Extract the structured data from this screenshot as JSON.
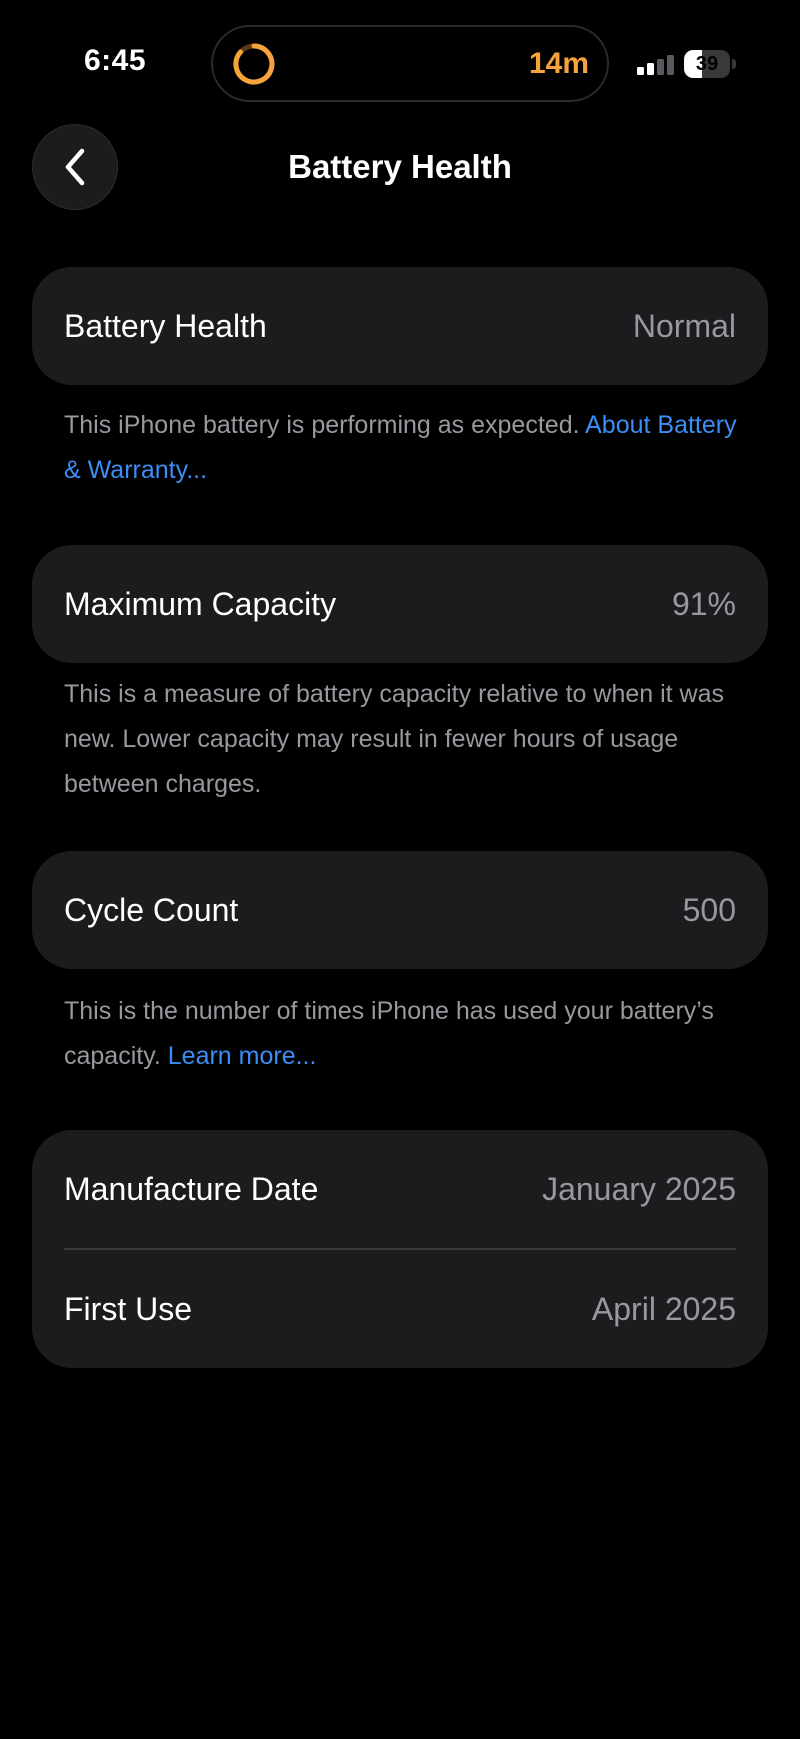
{
  "status_bar": {
    "time": "6:45",
    "timer": "14m",
    "battery_level": "39",
    "battery_fraction": 0.39
  },
  "nav": {
    "title": "Battery Health"
  },
  "battery_health": {
    "label": "Battery Health",
    "value": "Normal",
    "footnote": "This iPhone battery is performing as expected.",
    "link": "About Battery & Warranty..."
  },
  "maximum_capacity": {
    "label": "Maximum Capacity",
    "value": "91%",
    "footnote": "This is a measure of battery capacity relative to when it was new. Lower capacity may result in fewer hours of usage between charges."
  },
  "cycle_count": {
    "label": "Cycle Count",
    "value": "500",
    "footnote": "This is the number of times iPhone has used your battery’s capacity.",
    "link": "Learn more..."
  },
  "dates": {
    "manufacture_label": "Manufacture Date",
    "manufacture_value": "January 2025",
    "first_use_label": "First Use",
    "first_use_value": "April 2025"
  },
  "colors": {
    "background": "#000000",
    "card": "#1c1c1e",
    "link": "#3b8ef5",
    "timer": "#f7a33c",
    "secondary_text": "#98989f"
  },
  "icons": {
    "back": "chevron-left-icon",
    "timer": "timer-ring-icon",
    "signal": "cellular-signal-icon",
    "battery": "battery-icon"
  }
}
